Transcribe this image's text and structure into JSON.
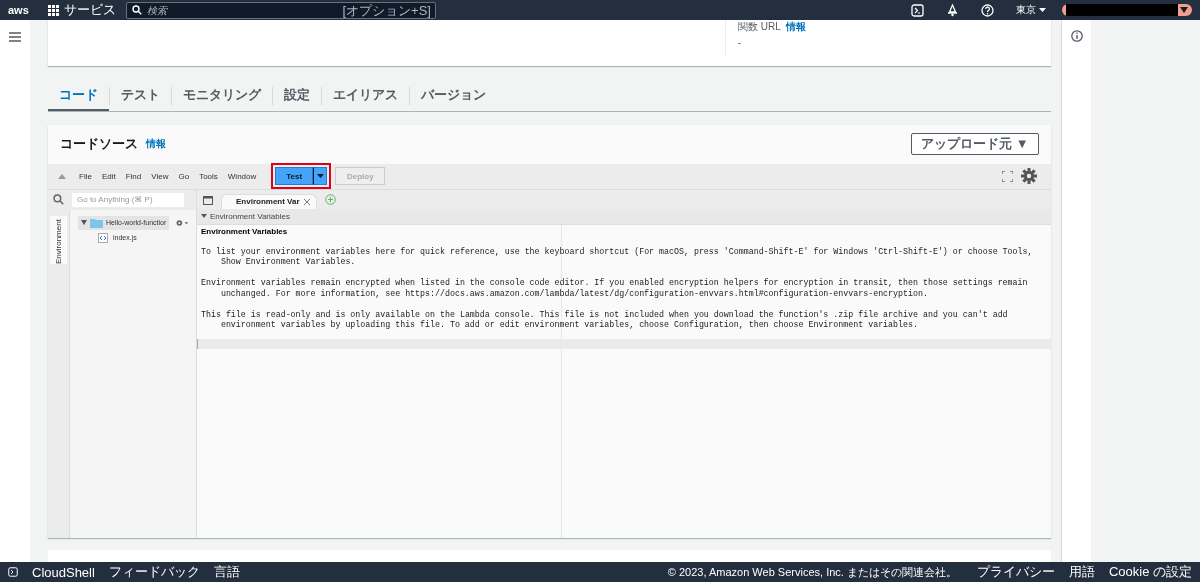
{
  "top_nav": {
    "logo": "aws",
    "services": "サービス",
    "search": {
      "placeholder": "検索",
      "shortcut": "[オプション+S]"
    },
    "region": "東京"
  },
  "function_card": {
    "label": "関数 URL",
    "info": "情報",
    "value": "-"
  },
  "tabs": [
    {
      "label": "コード",
      "selected": true
    },
    {
      "label": "テスト",
      "selected": false
    },
    {
      "label": "モニタリング",
      "selected": false
    },
    {
      "label": "設定",
      "selected": false
    },
    {
      "label": "エイリアス",
      "selected": false
    },
    {
      "label": "バージョン",
      "selected": false
    }
  ],
  "code_source": {
    "title": "コードソース",
    "info": "情報",
    "upload_button": "アップロード元 ▼",
    "menu": [
      "File",
      "Edit",
      "Find",
      "View",
      "Go",
      "Tools",
      "Window"
    ],
    "test_button": {
      "label": "Test",
      "highlighted": true
    },
    "deploy_button": {
      "label": "Deploy",
      "disabled": true
    },
    "goto": {
      "placeholder": "Go to Anything (⌘ P)"
    },
    "side_tab": "Environment",
    "tree": [
      {
        "name": "Hello-world-functior",
        "expanded": true,
        "children": [
          {
            "name": "index.js"
          }
        ]
      }
    ],
    "editor_tab": "Environment Var",
    "section": "Environment Variables",
    "heading": "Environment Variables",
    "paragraphs": [
      "To list your environment variables here for quick reference, use the keyboard shortcut (For macOS, press 'Command-Shift-E' for Windows 'Ctrl-Shift-E') or choose Tools, Show Environment Variables.",
      "Environment variables remain encrypted when listed in the console code editor. If you enabled encryption helpers for encryption in transit, then those settings remain unchanged. For more information, see https://docs.aws.amazon.com/lambda/latest/dg/configuration-envvars.html#configuration-envvars-encryption.",
      "This file is read-only and is only available on the Lambda console. This file is not included when you download the function's .zip file archive and you can't add environment variables by uploading this file. To add or edit environment variables, choose Configuration, then choose Environment variables."
    ]
  },
  "footer": {
    "left": [
      "CloudShell",
      "フィードバック",
      "言語"
    ],
    "copyright": "© 2023, Amazon Web Services, Inc. またはその関連会社。",
    "right": [
      "プライバシー",
      "用語",
      "Cookie の設定"
    ]
  }
}
